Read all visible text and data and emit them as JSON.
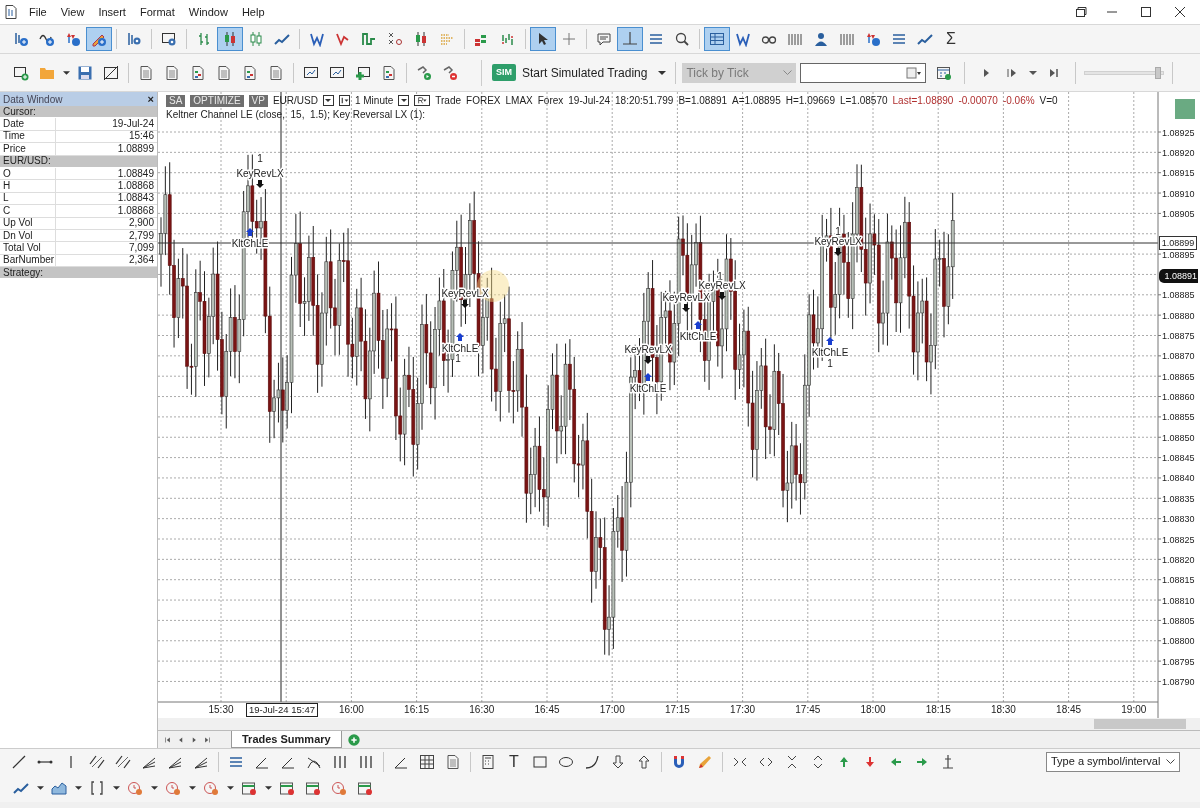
{
  "menu": {
    "items": [
      "File",
      "View",
      "Insert",
      "Format",
      "Window",
      "Help"
    ]
  },
  "toolbar_main": {
    "groups": [
      {
        "buttons": [
          {
            "kind": "bar-plus",
            "selected": false
          },
          {
            "kind": "wave-plus",
            "selected": false
          },
          {
            "kind": "arrows-plus",
            "selected": false
          },
          {
            "kind": "pencil",
            "selected": true
          }
        ]
      },
      {
        "buttons": [
          {
            "kind": "gear-bars",
            "selected": false
          }
        ]
      },
      {
        "buttons": [
          {
            "kind": "window-gear",
            "selected": false
          }
        ]
      },
      {
        "buttons": [
          {
            "kind": "ohlc",
            "selected": false
          },
          {
            "kind": "candles",
            "selected": true
          },
          {
            "kind": "hollow",
            "selected": false
          },
          {
            "kind": "line",
            "selected": false
          }
        ]
      },
      {
        "buttons": [
          {
            "kind": "zigzag",
            "selected": false
          },
          {
            "kind": "zigzag-red",
            "selected": false
          },
          {
            "kind": "step",
            "selected": false
          },
          {
            "kind": "xo",
            "selected": false
          },
          {
            "kind": "candles",
            "selected": false
          },
          {
            "kind": "dots",
            "selected": false
          }
        ]
      },
      {
        "buttons": [
          {
            "kind": "blocks",
            "selected": false
          },
          {
            "kind": "volume",
            "selected": false
          }
        ]
      },
      {
        "buttons": [
          {
            "kind": "cursor",
            "selected": true
          },
          {
            "kind": "cross",
            "selected": false
          }
        ]
      },
      {
        "buttons": [
          {
            "kind": "comment",
            "selected": false
          },
          {
            "kind": "hline",
            "selected": true
          },
          {
            "kind": "hlines",
            "selected": false
          },
          {
            "kind": "magnifier",
            "selected": false
          }
        ]
      },
      {
        "buttons": [
          {
            "kind": "table",
            "selected": true
          },
          {
            "kind": "zigzag",
            "selected": false
          },
          {
            "kind": "glasses",
            "selected": false
          },
          {
            "kind": "vbars",
            "selected": false
          },
          {
            "kind": "person",
            "selected": false
          },
          {
            "kind": "vbars",
            "selected": false
          },
          {
            "kind": "arrows-plus",
            "selected": false
          },
          {
            "kind": "hlines",
            "selected": false
          },
          {
            "kind": "line",
            "selected": false
          },
          {
            "kind": "glyph",
            "label": "Σ",
            "selected": false
          }
        ]
      }
    ]
  },
  "toolbar_secondary": {
    "groups": [
      {
        "buttons": [
          {
            "kind": "new-window",
            "selected": false
          },
          {
            "kind": "folder",
            "selected": false
          },
          {
            "kind": "caret",
            "selected": false
          },
          {
            "kind": "save",
            "selected": false
          },
          {
            "kind": "no-window",
            "selected": false
          }
        ]
      },
      {
        "buttons": [
          {
            "kind": "doc",
            "selected": false
          },
          {
            "kind": "doc",
            "selected": false
          },
          {
            "kind": "doc-color",
            "selected": false
          },
          {
            "kind": "doc",
            "selected": false
          },
          {
            "kind": "doc-color",
            "selected": false
          },
          {
            "kind": "doc",
            "selected": false
          }
        ]
      },
      {
        "buttons": [
          {
            "kind": "window-line",
            "selected": false
          },
          {
            "kind": "window-line",
            "selected": false
          },
          {
            "kind": "window-plus",
            "selected": false
          },
          {
            "kind": "doc-color",
            "selected": false
          }
        ]
      },
      {
        "buttons": [
          {
            "kind": "tool-play",
            "selected": false
          },
          {
            "kind": "tool-stop",
            "selected": false
          }
        ]
      }
    ]
  },
  "trading": {
    "sim_badge": "SIM",
    "sim_button": "Start Simulated Trading",
    "replay_mode": {
      "value": "Tick by Tick",
      "disabled": true
    },
    "playback_speed": {
      "level": 0.96
    }
  },
  "data_window": {
    "title": "Data Window",
    "close": "×",
    "rows": [
      {
        "kind": "section",
        "label": "Cursor:"
      },
      {
        "kind": "row",
        "label": "Date",
        "value": "19-Jul-24"
      },
      {
        "kind": "row",
        "label": "Time",
        "value": "15:46"
      },
      {
        "kind": "row",
        "label": "Price",
        "value": "1.08899"
      },
      {
        "kind": "section",
        "label": "EUR/USD:"
      },
      {
        "kind": "row",
        "label": "O",
        "value": "1.08849"
      },
      {
        "kind": "row",
        "label": "H",
        "value": "1.08868"
      },
      {
        "kind": "row",
        "label": "L",
        "value": "1.08843"
      },
      {
        "kind": "row",
        "label": "C",
        "value": "1.08868"
      },
      {
        "kind": "row",
        "label": "Up Vol",
        "value": "2,900"
      },
      {
        "kind": "row",
        "label": "Dn Vol",
        "value": "2,799"
      },
      {
        "kind": "row",
        "label": "Total Vol",
        "value": "7,099"
      },
      {
        "kind": "row",
        "label": "BarNumber",
        "value": "2,364"
      },
      {
        "kind": "section",
        "label": "Strategy:"
      }
    ]
  },
  "chart_header": {
    "buttons": [
      "SA",
      "OPTIMIZE",
      "VP"
    ],
    "symbol": "EUR/USD",
    "interval": "1 Minute",
    "quote": [
      {
        "kind": "plain",
        "text": "Trade"
      },
      {
        "kind": "plain",
        "text": "FOREX"
      },
      {
        "kind": "plain",
        "text": "LMAX"
      },
      {
        "kind": "plain",
        "text": "Forex"
      },
      {
        "kind": "plain",
        "text": "19-Jul-24"
      },
      {
        "kind": "plain",
        "text": "18:20:51.799"
      },
      {
        "kind": "plain",
        "text": "B=1.08891"
      },
      {
        "kind": "plain",
        "text": "A=1.08895"
      },
      {
        "kind": "plain",
        "text": "H=1.09669"
      },
      {
        "kind": "plain",
        "text": "L=1.08570"
      },
      {
        "kind": "change",
        "text": "Last=1.08890"
      },
      {
        "kind": "change",
        "text": "-0.00070"
      },
      {
        "kind": "change",
        "text": "-0.06%"
      },
      {
        "kind": "plain",
        "text": "V=0"
      }
    ],
    "strategies": "Keltner Channel LE (close,  15,  1.5); Key Reversal LX (1):"
  },
  "chart": {
    "markers": [
      {
        "kind": "count",
        "label": "1"
      },
      {
        "kind": "exit",
        "label": "KeyRevLX"
      },
      {
        "kind": "entry",
        "label": "KltChLE"
      },
      {
        "kind": "exit",
        "label": "KeyRevLX"
      },
      {
        "kind": "entry",
        "label": "KltChLE"
      },
      {
        "kind": "count",
        "label": "1"
      },
      {
        "kind": "exit",
        "label": "KeyRevLX"
      },
      {
        "kind": "entry",
        "label": "KltChLE"
      },
      {
        "kind": "count",
        "label": "1"
      },
      {
        "kind": "exit",
        "label": "KeyRevLX"
      },
      {
        "kind": "exit",
        "label": "KeyRevLX"
      },
      {
        "kind": "entry",
        "label": "KltChLE"
      },
      {
        "kind": "count",
        "label": "1"
      },
      {
        "kind": "exit",
        "label": "KeyRevLX"
      },
      {
        "kind": "entry",
        "label": "KltChLE"
      },
      {
        "kind": "count",
        "label": "1"
      }
    ]
  },
  "price_axis": {
    "labels": [
      "1.08925",
      "1.08920",
      "1.08915",
      "1.08910",
      "1.08905",
      "1.08895",
      "1.08885",
      "1.08880",
      "1.08875",
      "1.08870",
      "1.08865",
      "1.08860",
      "1.08855",
      "1.08850",
      "1.08845",
      "1.08840",
      "1.08835",
      "1.08830",
      "1.08825",
      "1.08820",
      "1.08815",
      "1.08810",
      "1.08805",
      "1.08800",
      "1.08795",
      "1.08790"
    ],
    "last_tag": "1.08899",
    "bid_tag": "1.08891"
  },
  "time_axis": {
    "labels": [
      "15:30",
      "16:00",
      "16:15",
      "16:30",
      "16:45",
      "17:00",
      "17:15",
      "17:30",
      "17:45",
      "18:00",
      "18:15",
      "18:30",
      "18:45",
      "19:00"
    ],
    "cursor_label": "19-Jul-24 15:47"
  },
  "sheet_tabs": [
    {
      "label": "Trades Summary",
      "selected": true
    }
  ],
  "drawing_toolbar": {
    "groups": [
      {
        "buttons": [
          {
            "kind": "diag",
            "selected": false
          },
          {
            "kind": "hseg",
            "selected": false
          },
          {
            "kind": "vseg",
            "selected": false
          },
          {
            "kind": "channel",
            "selected": false
          },
          {
            "kind": "channel",
            "selected": false
          },
          {
            "kind": "fan",
            "selected": false
          },
          {
            "kind": "fan",
            "selected": false
          },
          {
            "kind": "fan",
            "selected": false
          }
        ]
      },
      {
        "buttons": [
          {
            "kind": "hlines",
            "selected": false
          },
          {
            "kind": "angle",
            "selected": false
          },
          {
            "kind": "angle",
            "selected": false
          },
          {
            "kind": "xcross",
            "selected": false
          },
          {
            "kind": "vlines",
            "selected": false
          },
          {
            "kind": "vlines",
            "selected": false
          }
        ]
      },
      {
        "buttons": [
          {
            "kind": "angle",
            "selected": false
          },
          {
            "kind": "grid",
            "selected": false
          },
          {
            "kind": "doc",
            "selected": false
          }
        ]
      },
      {
        "buttons": [
          {
            "kind": "calc",
            "selected": false
          },
          {
            "kind": "glyph",
            "label": "T",
            "selected": false
          },
          {
            "kind": "rect",
            "selected": false
          },
          {
            "kind": "ellipse",
            "selected": false
          },
          {
            "kind": "arc",
            "selected": false
          },
          {
            "kind": "arrow-down",
            "selected": false
          },
          {
            "kind": "arrow-up",
            "selected": false
          }
        ]
      },
      {
        "buttons": [
          {
            "kind": "magnet",
            "selected": false
          },
          {
            "kind": "brush",
            "selected": false
          }
        ]
      },
      {
        "buttons": [
          {
            "kind": "collapse",
            "selected": false
          },
          {
            "kind": "expand",
            "selected": false
          },
          {
            "kind": "collapse-v",
            "selected": false
          },
          {
            "kind": "expand-v",
            "selected": false
          },
          {
            "kind": "up-green",
            "selected": false
          },
          {
            "kind": "down-red",
            "selected": false
          },
          {
            "kind": "left-green",
            "selected": false
          },
          {
            "kind": "right-green",
            "selected": false
          },
          {
            "kind": "axis",
            "selected": false
          }
        ]
      }
    ]
  },
  "symbol_box": {
    "placeholder": "Type a symbol/interval"
  },
  "indicator_toolbar": {
    "groups": [
      {
        "buttons": [
          {
            "kind": "line",
            "selected": false
          },
          {
            "kind": "caret",
            "selected": false
          },
          {
            "kind": "area",
            "selected": false
          },
          {
            "kind": "caret",
            "selected": false
          },
          {
            "kind": "bracket",
            "selected": false
          },
          {
            "kind": "caret",
            "selected": false
          },
          {
            "kind": "clock",
            "selected": false
          },
          {
            "kind": "caret",
            "selected": false
          },
          {
            "kind": "clock",
            "selected": false
          },
          {
            "kind": "caret",
            "selected": false
          },
          {
            "kind": "clock",
            "selected": false
          },
          {
            "kind": "caret",
            "selected": false
          },
          {
            "kind": "calendar",
            "selected": false
          },
          {
            "kind": "caret",
            "selected": false
          },
          {
            "kind": "calendar",
            "selected": false
          },
          {
            "kind": "calendar",
            "selected": false
          },
          {
            "kind": "clock",
            "selected": false
          },
          {
            "kind": "calendar",
            "selected": false
          }
        ]
      }
    ]
  }
}
